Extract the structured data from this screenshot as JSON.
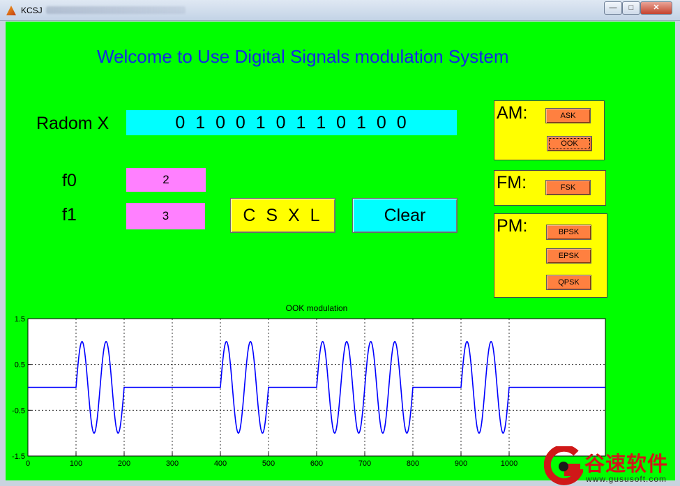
{
  "window": {
    "title": "KCSJ",
    "controls": {
      "minimize": "—",
      "maximize": "□",
      "close": "✕"
    }
  },
  "figure": {
    "heading": "Welcome to Use Digital Signals modulation System",
    "radom_label": "Radom X",
    "bits": "0 1 0 0 1 0 1 1 0 1 0 0",
    "f0_label": "f0",
    "f0_value": "2",
    "f1_label": "f1",
    "f1_value": "3",
    "csxl_button": "C S X L",
    "clear_button": "Clear"
  },
  "panels": {
    "am": {
      "title": "AM:",
      "buttons": [
        "ASK",
        "OOK"
      ]
    },
    "fm": {
      "title": "FM:",
      "buttons": [
        "FSK"
      ]
    },
    "pm": {
      "title": "PM:",
      "buttons": [
        "BPSK",
        "EPSK",
        "QPSK"
      ]
    }
  },
  "colors": {
    "figure_bg": "#00ff00",
    "heading": "#1428e6",
    "bits_bg": "#00ffff",
    "freq_bg": "#ff80ff",
    "panel_bg": "#ffff00",
    "small_button": "#ff8040",
    "signal": "#0000ff"
  },
  "chart_data": {
    "type": "line",
    "title": "OOK modulation",
    "xlabel": "",
    "ylabel": "",
    "xlim": [
      0,
      1200
    ],
    "ylim": [
      -1.5,
      1.5
    ],
    "xticks": [
      0,
      100,
      200,
      300,
      400,
      500,
      600,
      700,
      800,
      900,
      1000
    ],
    "yticks": [
      1.5,
      0.5,
      -0.5,
      -1.5
    ],
    "ytick_labels": [
      "1.5",
      "0.5",
      "-0.5",
      "-1.5"
    ],
    "grid": true,
    "bits": [
      0,
      1,
      0,
      0,
      1,
      0,
      1,
      1,
      0,
      1,
      0,
      0
    ],
    "samples_per_bit": 100,
    "cycles_per_bit": 2,
    "baseline": 0,
    "amplitude": 1
  },
  "watermark": {
    "brand": "谷速软件",
    "url": "www.gususoft.com"
  }
}
